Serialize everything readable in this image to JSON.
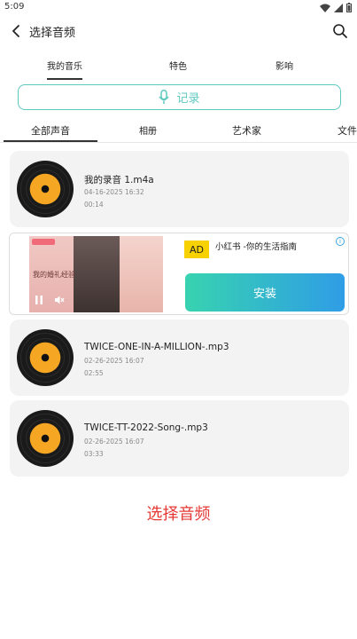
{
  "status_bar": {
    "time": "5:09"
  },
  "header": {
    "title": "选择音频"
  },
  "top_tabs": [
    {
      "label": "我的音乐"
    },
    {
      "label": "特色"
    },
    {
      "label": "影响"
    }
  ],
  "record_button": {
    "label": "记录"
  },
  "category_tabs": [
    {
      "label": "全部声音"
    },
    {
      "label": "相册"
    },
    {
      "label": "艺术家"
    },
    {
      "label": "文件"
    }
  ],
  "audio_items": [
    {
      "name": "我的录音 1.m4a",
      "date": "04-16-2025 16:32",
      "duration": "00:14"
    },
    {
      "name": "TWICE-ONE-IN-A-MILLION-.mp3",
      "date": "02-26-2025 16:07",
      "duration": "02:55"
    },
    {
      "name": "TWICE-TT-2022-Song-.mp3",
      "date": "02-26-2025 16:07",
      "duration": "03:33"
    }
  ],
  "ad": {
    "badge": "AD",
    "title": "小红书 -你的生活指南",
    "install_label": "安装",
    "image_text": "我的婚礼经验"
  },
  "footer": {
    "select_label": "选择音频"
  },
  "colors": {
    "accent": "#5fc9c0",
    "select_red": "#e53935",
    "ad_yellow": "#f7d100"
  }
}
